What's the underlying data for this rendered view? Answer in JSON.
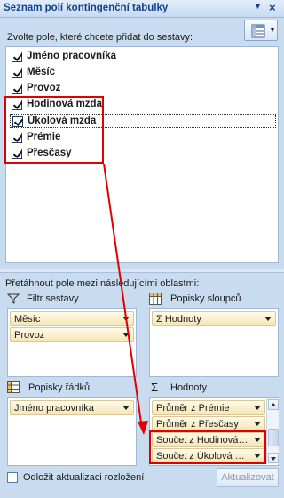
{
  "panel": {
    "title": "Seznam polí kontingenční tabulky",
    "dropdown_icon": "chevron-down-icon",
    "close_icon": "close-icon"
  },
  "fields_section": {
    "prompt": "Zvolte pole, které chcete přidat do sestavy:",
    "layout_button_icon": "field-layout-icon",
    "fields": [
      {
        "label": "Jméno pracovníka",
        "checked": true
      },
      {
        "label": "Měsíc",
        "checked": true
      },
      {
        "label": "Provoz",
        "checked": true
      },
      {
        "label": "Hodinová mzda",
        "checked": true
      },
      {
        "label": "Úkolová mzda",
        "checked": true
      },
      {
        "label": "Prémie",
        "checked": true
      },
      {
        "label": "Přesčasy",
        "checked": true
      }
    ]
  },
  "areas_section": {
    "prompt": "Přetáhnout pole mezi následujícími oblastmi:",
    "report_filter": {
      "label": "Filtr sestavy",
      "icon": "filter-icon",
      "items": [
        "Měsíc",
        "Provoz"
      ]
    },
    "column_labels": {
      "label": "Popisky sloupců",
      "icon": "column-grid-icon",
      "items": [
        "Σ Hodnoty"
      ]
    },
    "row_labels": {
      "label": "Popisky řádků",
      "icon": "row-grid-icon",
      "items": [
        "Jméno pracovníka"
      ]
    },
    "values": {
      "label": "Hodnoty",
      "icon": "sigma-icon",
      "items": [
        "Průměr z Prémie",
        "Průměr z Přesčasy",
        "Součet z Hodinová…",
        "Součet z Úkolová …"
      ]
    }
  },
  "footer": {
    "defer_label": "Odložit aktualizaci rozložení",
    "defer_checked": false,
    "update_button": "Aktualizovat"
  },
  "colors": {
    "panel_bg": "#c9dcef",
    "title_text": "#15428b",
    "highlight": "#e00000",
    "chip_bg": "#f4e6b4"
  }
}
